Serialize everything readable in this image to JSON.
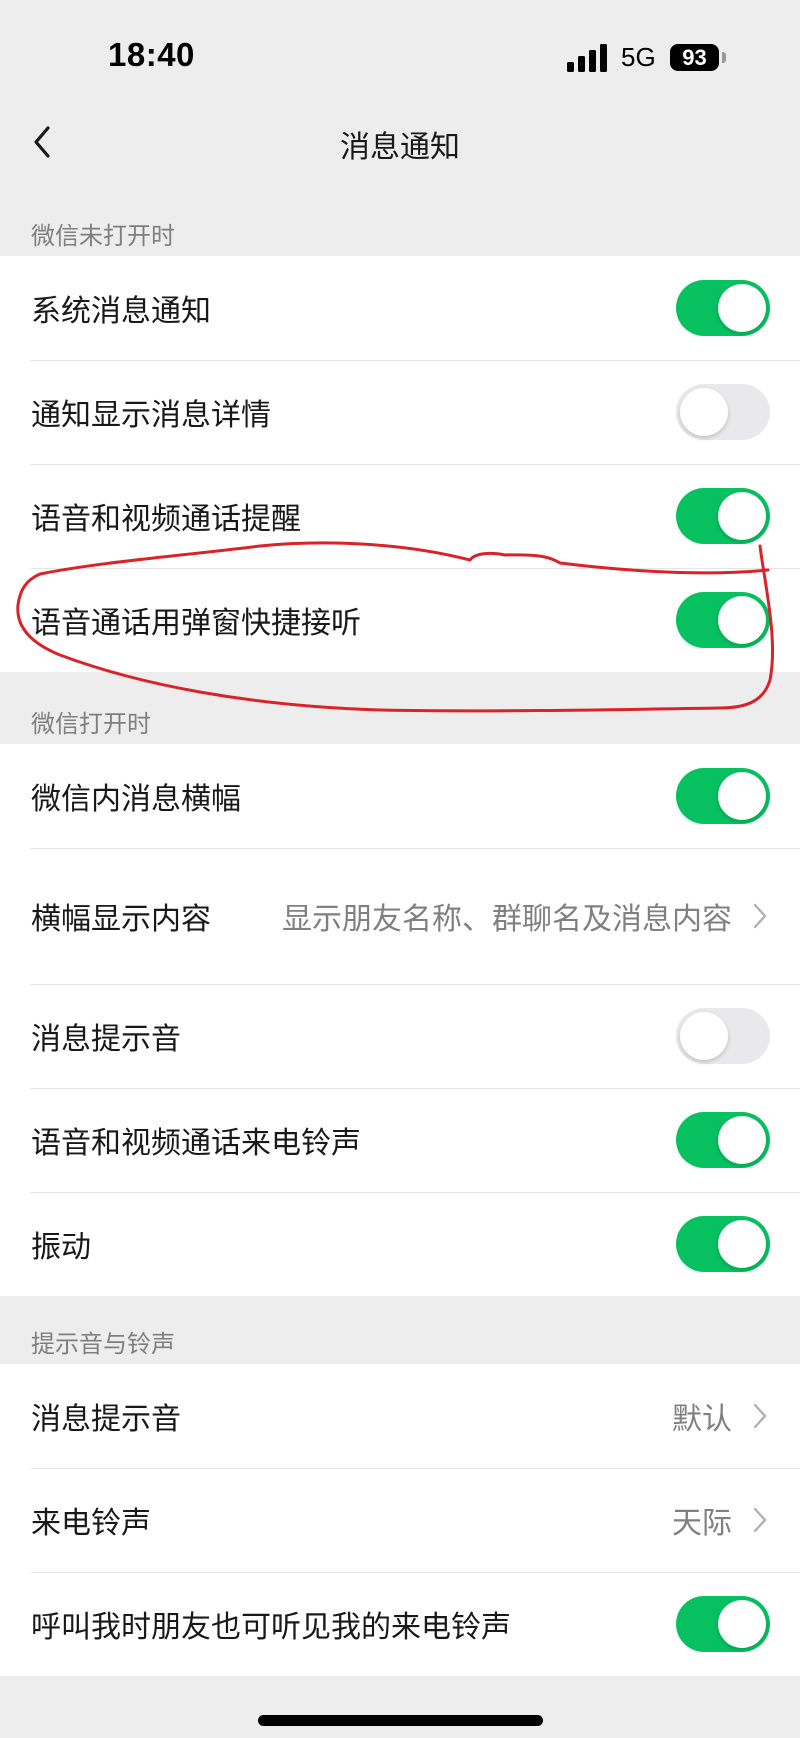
{
  "status_bar": {
    "time": "18:40",
    "network": "5G",
    "battery": "93"
  },
  "nav": {
    "title": "消息通知",
    "back_icon": "chevron-left-icon"
  },
  "sections": {
    "closed": {
      "header": "微信未打开时",
      "items": [
        {
          "label": "系统消息通知",
          "on": true
        },
        {
          "label": "通知显示消息详情",
          "on": false
        },
        {
          "label": "语音和视频通话提醒",
          "on": true
        },
        {
          "label": "语音通话用弹窗快捷接听",
          "on": true
        }
      ]
    },
    "open": {
      "header": "微信打开时",
      "items": [
        {
          "label": "微信内消息横幅",
          "on": true
        },
        {
          "label": "横幅显示内容",
          "value": "显示朋友名称、群聊名及消息内容"
        },
        {
          "label": "消息提示音",
          "on": false
        },
        {
          "label": "语音和视频通话来电铃声",
          "on": true
        },
        {
          "label": "振动",
          "on": true
        }
      ]
    },
    "sounds": {
      "header": "提示音与铃声",
      "items": [
        {
          "label": "消息提示音",
          "value": "默认"
        },
        {
          "label": "来电铃声",
          "value": "天际"
        },
        {
          "label": "呼叫我时朋友也可听见我的来电铃声",
          "on": true
        }
      ]
    }
  },
  "colors": {
    "toggle_on": "#07c160",
    "toggle_off": "#e9e9eb",
    "background": "#ededed",
    "annotation": "#d9232a"
  }
}
